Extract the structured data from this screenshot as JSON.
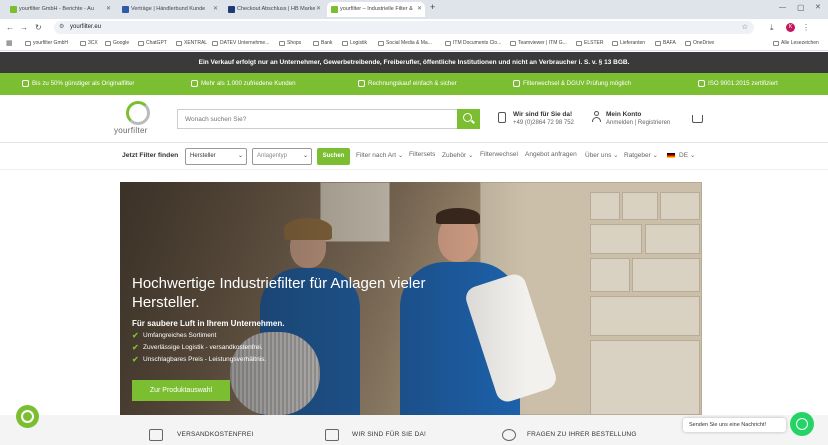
{
  "browser": {
    "tabs": [
      {
        "title": "yourfilter GmbH - Berichte - Au",
        "favcolor": "#7cbe31"
      },
      {
        "title": "Verträge | Händlerbund Kunde",
        "favcolor": "#2e5aa8"
      },
      {
        "title": "Checkout Abschluss | HB Marke",
        "favcolor": "#1f3b73"
      },
      {
        "title": "yourfilter – Industrielle Filter &",
        "favcolor": "#7cbe31"
      }
    ],
    "new_tab": "+",
    "url": "yourfilter.eu",
    "bookmarks": [
      "yourfilter GmbH",
      "3CX",
      "Google",
      "ChatGPT",
      "XENTRAL",
      "DATEV Unternehme...",
      "Shops",
      "Bank",
      "Logistik",
      "Social Media & Ma...",
      "ITM Documents Clo...",
      "Teamviewer | ITM G...",
      "ELSTER",
      "Lieferanten",
      "BAFA",
      "OneDrive"
    ],
    "all_bookmarks": "Alle Lesezeichen",
    "profile_initial": "K"
  },
  "notice": "Ein Verkauf erfolgt nur an Unternehmer, Gewerbetreibende, Freiberufler, öffentliche Institutionen und nicht an Verbraucher i. S. v. § 13 BGB.",
  "usps": [
    "Bis zu 50% günstiger als Originalfilter",
    "Mehr als 1.000 zufriedene Kunden",
    "Rechnungskauf einfach & sicher",
    "Filterwechsel & DGUV Prüfung möglich",
    "ISO 9001:2015 zertifiziert"
  ],
  "header": {
    "logo_text": "yourfilter",
    "search_placeholder": "Wonach suchen Sie?",
    "contact_title": "Wir sind für Sie da!",
    "contact_phone": "+49 (0)2864 72 98 752",
    "account_title": "Mein Konto",
    "account_links": "Anmelden | Registrieren"
  },
  "subnav": {
    "filter_label": "Jetzt Filter finden",
    "select_hersteller": "Hersteller",
    "select_anlagentyp": "Anlagentyp",
    "suchen": "Suchen",
    "menu": [
      "Filter nach Art",
      "Filtersets",
      "Zubehör",
      "Filterwechsel",
      "Angebot anfragen",
      "Über uns",
      "Ratgeber",
      "DE"
    ]
  },
  "hero": {
    "title": "Hochwertige Industriefilter für Anlagen vieler Hersteller.",
    "subtitle": "Für saubere Luft in Ihrem Unternehmen.",
    "checks": [
      "Umfangreiches Sortiment",
      "Zuverlässige Logistik - versandkostenfrei.",
      "Unschlagbares Preis - Leistungsverhältnis."
    ],
    "cta": "Zur Produktauswahl"
  },
  "features": [
    "VERSANDKOSTENFREI",
    "WIR SIND FÜR SIE DA!",
    "FRAGEN ZU IHRER BESTELLUNG"
  ],
  "chat": "Senden Sie uns eine Nachricht!",
  "colors": {
    "brand_green": "#7cbe31",
    "dark_bar": "#3a3a3a",
    "whatsapp": "#25d366"
  }
}
